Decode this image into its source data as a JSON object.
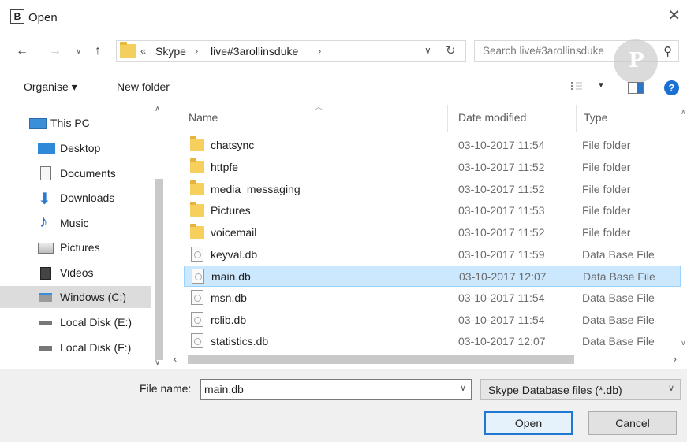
{
  "window": {
    "title": "Open",
    "app_icon_letter": "B"
  },
  "address": {
    "crumbs": [
      "Skype",
      "live#3arollinsduke"
    ],
    "overflow": "«",
    "separator": "›"
  },
  "search": {
    "placeholder": "Search live#3arollinsduke"
  },
  "toolbar": {
    "organise_label": "Organise ▾",
    "new_folder_label": "New folder",
    "help_label": "?"
  },
  "nav": {
    "items": [
      {
        "label": "This PC",
        "icon": "pc-icon"
      },
      {
        "label": "Desktop",
        "icon": "desktop-icon"
      },
      {
        "label": "Documents",
        "icon": "documents-icon"
      },
      {
        "label": "Downloads",
        "icon": "downloads-icon"
      },
      {
        "label": "Music",
        "icon": "music-icon"
      },
      {
        "label": "Pictures",
        "icon": "pictures-icon"
      },
      {
        "label": "Videos",
        "icon": "videos-icon"
      },
      {
        "label": "Windows (C:)",
        "icon": "drive-icon"
      },
      {
        "label": "Local Disk (E:)",
        "icon": "disk-icon"
      },
      {
        "label": "Local Disk (F:)",
        "icon": "disk-icon"
      }
    ],
    "selected": "Windows (C:)"
  },
  "columns": {
    "name": "Name",
    "date": "Date modified",
    "type": "Type"
  },
  "files": [
    {
      "name": "chatsync",
      "date": "03-10-2017 11:54",
      "type": "File folder",
      "kind": "folder"
    },
    {
      "name": "httpfe",
      "date": "03-10-2017 11:52",
      "type": "File folder",
      "kind": "folder"
    },
    {
      "name": "media_messaging",
      "date": "03-10-2017 11:52",
      "type": "File folder",
      "kind": "folder"
    },
    {
      "name": "Pictures",
      "date": "03-10-2017 11:53",
      "type": "File folder",
      "kind": "folder"
    },
    {
      "name": "voicemail",
      "date": "03-10-2017 11:52",
      "type": "File folder",
      "kind": "folder"
    },
    {
      "name": "keyval.db",
      "date": "03-10-2017 11:59",
      "type": "Data Base File",
      "kind": "file"
    },
    {
      "name": "main.db",
      "date": "03-10-2017 12:07",
      "type": "Data Base File",
      "kind": "file"
    },
    {
      "name": "msn.db",
      "date": "03-10-2017 11:54",
      "type": "Data Base File",
      "kind": "file"
    },
    {
      "name": "rclib.db",
      "date": "03-10-2017 11:54",
      "type": "Data Base File",
      "kind": "file"
    },
    {
      "name": "statistics.db",
      "date": "03-10-2017 12:07",
      "type": "Data Base File",
      "kind": "file"
    }
  ],
  "selected_file": "main.db",
  "footer": {
    "file_name_label": "File name:",
    "file_name_value": "main.db",
    "file_type": "Skype Database files (*.db)",
    "open_label": "Open",
    "cancel_label": "Cancel"
  },
  "colors": {
    "selection": "#cce8ff",
    "accent": "#1f78d1",
    "folder": "#f6cf5d"
  }
}
